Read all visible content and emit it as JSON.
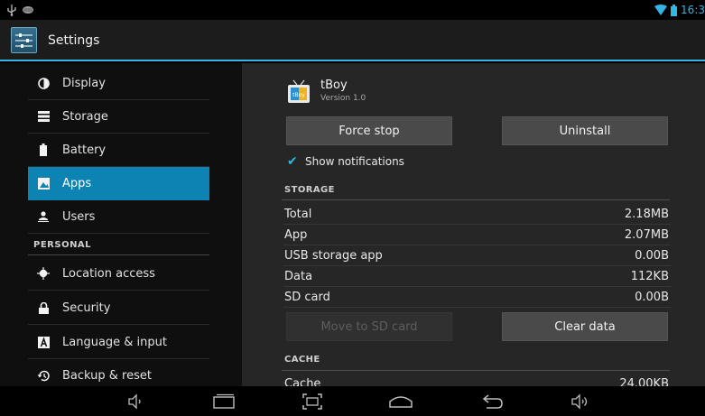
{
  "status_bar": {
    "time": "16:3",
    "left_icons": [
      "usb-icon",
      "notification-icon"
    ],
    "right_icons": [
      "wifi-icon",
      "battery-icon"
    ]
  },
  "action_bar": {
    "title": "Settings",
    "icon": "settings-app-icon"
  },
  "sidebar": {
    "items": [
      {
        "label": "Display",
        "icon": "display-icon"
      },
      {
        "label": "Storage",
        "icon": "storage-icon"
      },
      {
        "label": "Battery",
        "icon": "battery-icon"
      },
      {
        "label": "Apps",
        "icon": "apps-icon",
        "active": true
      },
      {
        "label": "Users",
        "icon": "users-icon"
      }
    ],
    "personal_header": "PERSONAL",
    "personal_items": [
      {
        "label": "Location access",
        "icon": "location-icon"
      },
      {
        "label": "Security",
        "icon": "lock-icon"
      },
      {
        "label": "Language & input",
        "icon": "language-icon"
      },
      {
        "label": "Backup & reset",
        "icon": "backup-icon"
      }
    ]
  },
  "app_info": {
    "name": "tBoy",
    "version": "Version 1.0",
    "icon_text": "tBoy",
    "force_stop_label": "Force stop",
    "uninstall_label": "Uninstall",
    "show_notifications_label": "Show notifications",
    "show_notifications_checked": true,
    "storage_header": "STORAGE",
    "storage_rows": [
      {
        "label": "Total",
        "value": "2.18MB"
      },
      {
        "label": "App",
        "value": "2.07MB"
      },
      {
        "label": "USB storage app",
        "value": "0.00B"
      },
      {
        "label": "Data",
        "value": "112KB"
      },
      {
        "label": "SD card",
        "value": "0.00B"
      }
    ],
    "move_to_sd_label": "Move to SD card",
    "clear_data_label": "Clear data",
    "cache_header": "CACHE",
    "cache_rows": [
      {
        "label": "Cache",
        "value": "24.00KB"
      }
    ]
  },
  "nav_bar": {
    "buttons": [
      "volume-down-icon",
      "recent-apps-icon",
      "screenshot-icon",
      "home-icon",
      "back-icon",
      "volume-up-icon"
    ]
  },
  "colors": {
    "accent": "#33b5e5",
    "active_item": "#0d83b4"
  }
}
